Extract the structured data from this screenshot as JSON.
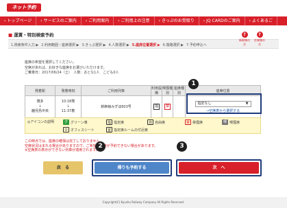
{
  "header": {
    "logo_text": "ネット予約",
    "nav": [
      "トップページ",
      "サービスのご案内",
      "ご利用案内",
      "ご利用上の注意",
      "きっぷのお受取り",
      "JQ CARDのご案内",
      "よくあるご"
    ]
  },
  "page": {
    "title": "運賃・特別検索予約",
    "steps": [
      "検索条件入力",
      "利用範囲・座席選択",
      "きっぷ選択",
      "人数選択",
      "座席位置選択",
      "復路選択",
      "予約申込へ"
    ],
    "active_step": 4,
    "help1": "新幹線の方",
    "help2": "在来線の方"
  },
  "info": {
    "line1": "座席の希望を選択してください。",
    "line2": "空席があれば、お好きな座席をお選びいただけます。",
    "line3": "ご乗車日：2017/06/24（土）　人数：おとな1人　こども0人"
  },
  "table": {
    "headers": [
      "発着駅",
      "発着時刻",
      "ご利用列車",
      "利用設備",
      "喫煙種別",
      "座席種別",
      "座席位置"
    ],
    "row": {
      "from": "博多",
      "to": "鹿児島中央",
      "dep_time": "10:18発",
      "arr_time": "11:37着",
      "train": "新幹線みずほ603号",
      "facility": "指",
      "smoking": "禁",
      "seat_type": "",
      "seat_position_value": "指定なし",
      "seat_position_link": "→空席表から選択する"
    }
  },
  "legend": {
    "title": "◎アイコンの説明",
    "items": [
      {
        "icon": "グ",
        "label": "グリーン車",
        "color": "#2e9d3a"
      },
      {
        "icon": "指",
        "label": "指定席",
        "color": "#ffffff"
      },
      {
        "icon": "自",
        "label": "自由席",
        "color": "#ffffff"
      },
      {
        "icon": "禁",
        "label": "禁煙席",
        "color": "#d8202a"
      },
      {
        "icon": "喫",
        "label": "喫煙席",
        "color": "#777777"
      },
      {
        "icon": "O",
        "label": "オフィスシート",
        "color": "#ffffff"
      },
      {
        "icon": "室",
        "label": "指定席ルームの付近席",
        "color": "#ffffff"
      }
    ]
  },
  "notes": {
    "line1": "この時点では、座席の確保は完了しておりません。",
    "line2": "空席状況はまれる場合がありますので、ご希望の座席が予約できない場合があります。",
    "line3": "※空席表の表示ができない列車が適用されます。"
  },
  "buttons": {
    "back": "戻　る",
    "return_trip": "帰りも予約する",
    "next": "次　へ"
  },
  "badges": [
    "1",
    "2",
    "3"
  ],
  "footer": "Copyright(C) Kyushu Railway Company All Rights Reserved."
}
